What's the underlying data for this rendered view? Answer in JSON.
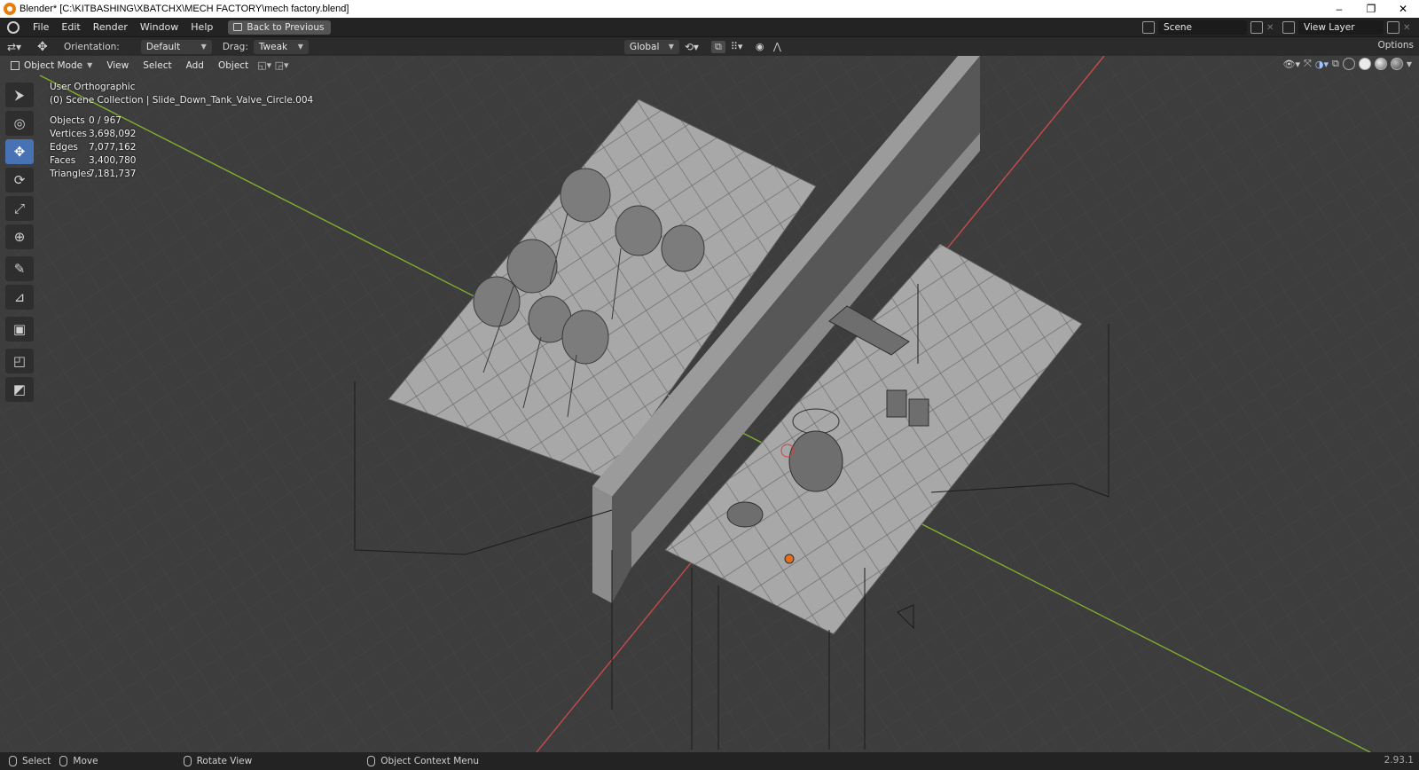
{
  "window": {
    "title": "Blender* [C:\\KITBASHING\\XBATCHX\\MECH FACTORY\\mech factory.blend]",
    "min_glyph": "–",
    "max_glyph": "❐",
    "close_glyph": "✕"
  },
  "menubar": {
    "items": [
      "File",
      "Edit",
      "Render",
      "Window",
      "Help"
    ],
    "back_label": "Back to Previous",
    "scene_value": "Scene",
    "view_layer_value": "View Layer"
  },
  "toolheader": {
    "orientation_label": "Orientation:",
    "orientation_value": "Default",
    "drag_label": "Drag:",
    "drag_value": "Tweak",
    "transform_orientation": "Global",
    "options_label": "Options"
  },
  "viewport_header": {
    "mode": "Object Mode",
    "menus": [
      "View",
      "Select",
      "Add",
      "Object"
    ]
  },
  "overlay": {
    "view_name": "User Orthographic",
    "collection": "(0) Scene Collection | Slide_Down_Tank_Valve_Circle.004",
    "stats": [
      {
        "label": "Objects",
        "value": "0 / 967"
      },
      {
        "label": "Vertices",
        "value": "3,698,092"
      },
      {
        "label": "Edges",
        "value": "7,077,162"
      },
      {
        "label": "Faces",
        "value": "3,400,780"
      },
      {
        "label": "Triangles",
        "value": "7,181,737"
      }
    ]
  },
  "tools": [
    {
      "icon": "select-cursor-icon",
      "glyph": "⮞"
    },
    {
      "icon": "cursor-icon",
      "glyph": "◎"
    },
    {
      "icon": "move-icon",
      "glyph": "✥"
    },
    {
      "icon": "rotate-icon",
      "glyph": "⟳"
    },
    {
      "icon": "scale-icon",
      "glyph": "⤢"
    },
    {
      "icon": "transform-icon",
      "glyph": "⊕"
    },
    {
      "icon": "annotate-icon",
      "glyph": "✎"
    },
    {
      "icon": "measure-icon",
      "glyph": "⊿"
    },
    {
      "icon": "add-cube-icon",
      "glyph": "▣"
    },
    {
      "icon": "extra-tool-1-icon",
      "glyph": "◰"
    },
    {
      "icon": "extra-tool-2-icon",
      "glyph": "◩"
    }
  ],
  "statusbar": {
    "select": "Select",
    "move": "Move",
    "rotate": "Rotate View",
    "context": "Object Context Menu",
    "version": "2.93.1"
  },
  "colors": {
    "accent": "#4772b3",
    "viewport": "#3d3d3d",
    "x_axis": "#c84b4b",
    "y_axis": "#7fae2f"
  }
}
